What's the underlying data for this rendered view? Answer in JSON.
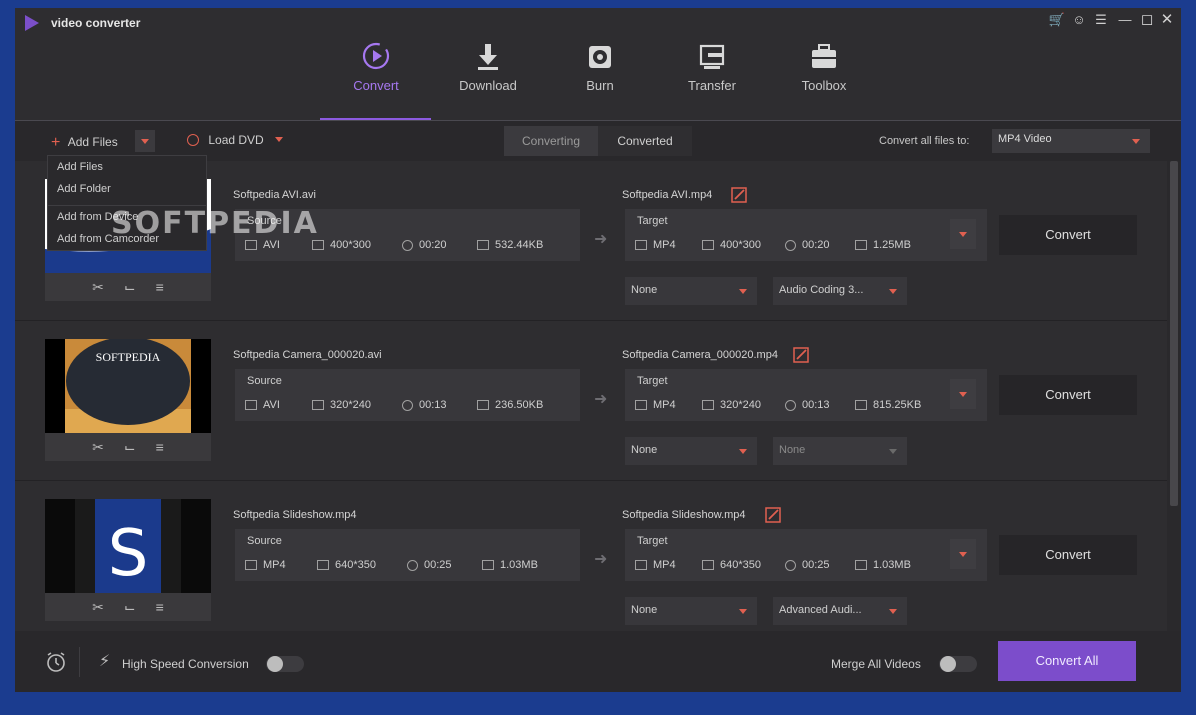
{
  "app": {
    "title": "video converter"
  },
  "window_controls": [
    "cart-icon",
    "user-icon",
    "menu-icon",
    "minimize-icon",
    "maximize-icon",
    "close-icon"
  ],
  "nav": {
    "items": [
      {
        "label": "Convert",
        "icon": "convert-icon",
        "active": true
      },
      {
        "label": "Download",
        "icon": "download-icon"
      },
      {
        "label": "Burn",
        "icon": "disc-icon"
      },
      {
        "label": "Transfer",
        "icon": "transfer-icon"
      },
      {
        "label": "Toolbox",
        "icon": "toolbox-icon"
      }
    ]
  },
  "toolbar": {
    "add_files": "Add Files",
    "load_dvd": "Load DVD",
    "tab_converting": "Converting",
    "tab_converted": "Converted",
    "convert_all_label": "Convert all files to:",
    "convert_all_value": "MP4 Video"
  },
  "add_menu": {
    "items": [
      "Add Files",
      "Add Folder",
      "Add from Device",
      "Add from Camcorder"
    ]
  },
  "watermark": "SOFTPEDIA",
  "files": [
    {
      "source_name": "Softpedia AVI.avi",
      "target_name": "Softpedia AVI.mp4",
      "source_label": "Source",
      "target_label": "Target",
      "source": {
        "format": "AVI",
        "resolution": "400*300",
        "duration": "00:20",
        "size": "532.44KB"
      },
      "target": {
        "format": "MP4",
        "resolution": "400*300",
        "duration": "00:20",
        "size": "1.25MB"
      },
      "subtitle": "None",
      "audio": "Audio Coding 3...",
      "convert_label": "Convert"
    },
    {
      "source_name": "Softpedia Camera_000020.avi",
      "target_name": "Softpedia Camera_000020.mp4",
      "source_label": "Source",
      "target_label": "Target",
      "source": {
        "format": "AVI",
        "resolution": "320*240",
        "duration": "00:13",
        "size": "236.50KB"
      },
      "target": {
        "format": "MP4",
        "resolution": "320*240",
        "duration": "00:13",
        "size": "815.25KB"
      },
      "subtitle": "None",
      "audio": "None",
      "thumb_text": "SOFTPEDIA",
      "convert_label": "Convert"
    },
    {
      "source_name": "Softpedia Slideshow.mp4",
      "target_name": "Softpedia Slideshow.mp4",
      "source_label": "Source",
      "target_label": "Target",
      "source": {
        "format": "MP4",
        "resolution": "640*350",
        "duration": "00:25",
        "size": "1.03MB"
      },
      "target": {
        "format": "MP4",
        "resolution": "640*350",
        "duration": "00:25",
        "size": "1.03MB"
      },
      "subtitle": "None",
      "audio": "Advanced Audi...",
      "thumb_text": "S",
      "convert_label": "Convert"
    }
  ],
  "footer": {
    "high_speed": "High Speed Conversion",
    "merge": "Merge All Videos",
    "convert_all": "Convert All"
  },
  "colors": {
    "accent": "#7c4dcb",
    "nav_active": "#a678f0",
    "warning": "#e06050"
  }
}
